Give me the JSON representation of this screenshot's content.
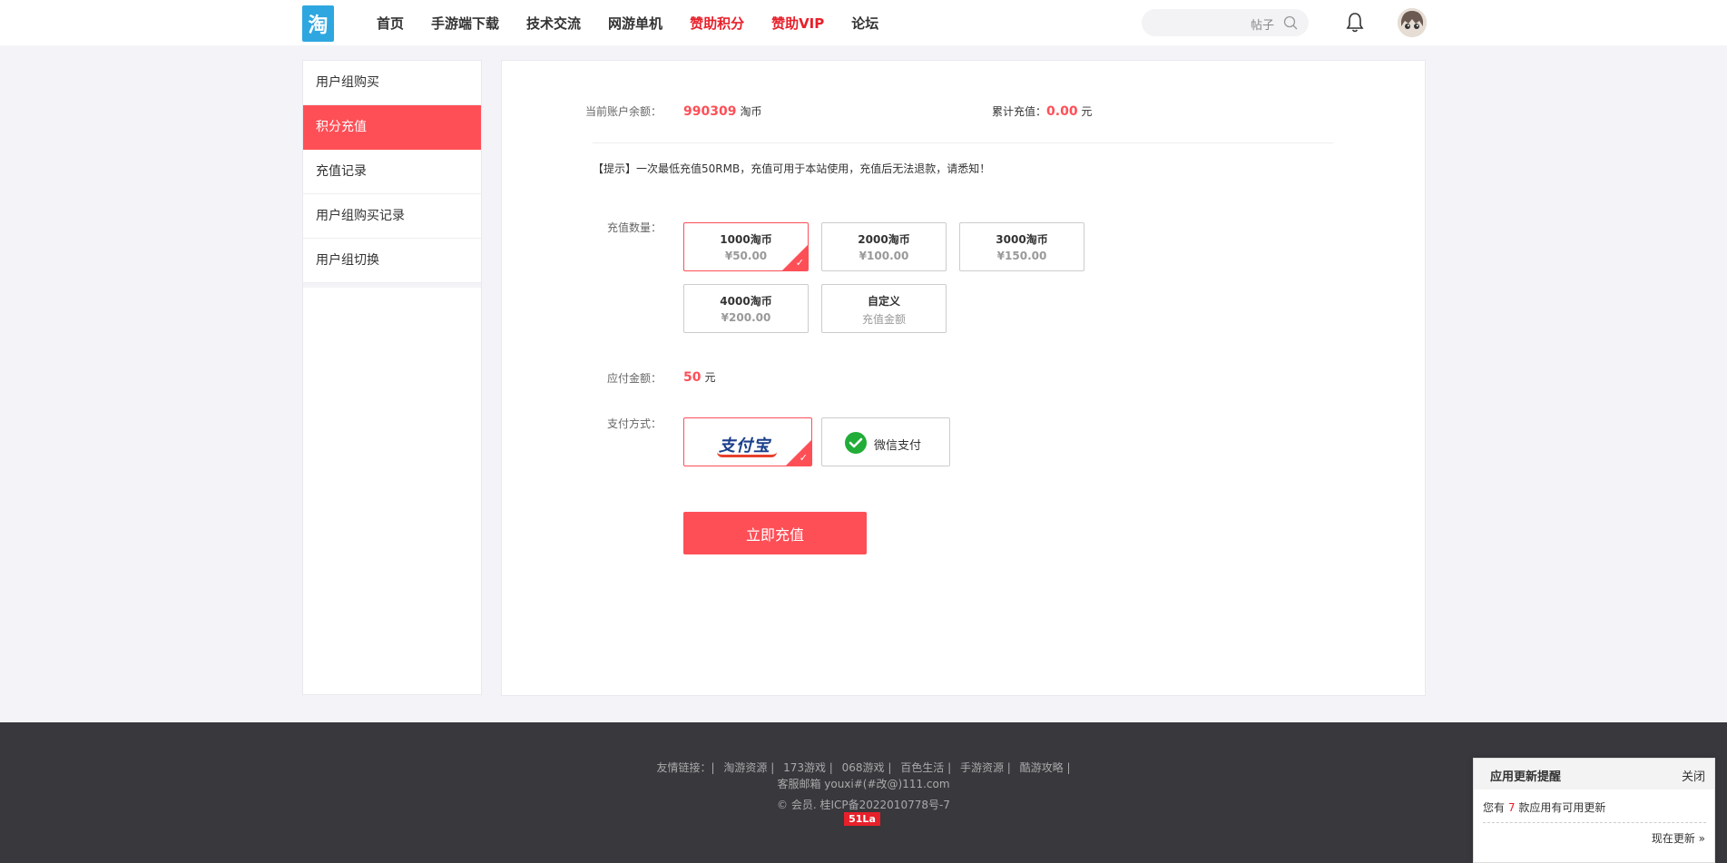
{
  "header": {
    "logo_text": "淘",
    "nav": [
      {
        "label": "首页",
        "accent": false
      },
      {
        "label": "手游端下载",
        "accent": false
      },
      {
        "label": "技术交流",
        "accent": false
      },
      {
        "label": "网游单机",
        "accent": false
      },
      {
        "label": "赞助积分",
        "accent": true
      },
      {
        "label": "赞助VIP",
        "accent": true
      },
      {
        "label": "论坛",
        "accent": false
      }
    ],
    "search_placeholder": "帖子"
  },
  "sidebar": {
    "items": [
      {
        "label": "用户组购买",
        "active": false
      },
      {
        "label": "积分充值",
        "active": true
      },
      {
        "label": "充值记录",
        "active": false
      },
      {
        "label": "用户组购买记录",
        "active": false
      },
      {
        "label": "用户组切换",
        "active": false
      }
    ]
  },
  "recharge": {
    "balance_label": "当前账户余额：",
    "balance_value": "990309",
    "balance_unit": "淘币",
    "total_label": "累计充值：",
    "total_value": "0.00",
    "total_unit": "元",
    "tip": "【提示】一次最低充值50RMB，充值可用于本站使用，充值后无法退款，请悉知！",
    "amount_label": "充值数量：",
    "options": [
      {
        "name": "1000淘币",
        "price": "¥50.00",
        "selected": true
      },
      {
        "name": "2000淘币",
        "price": "¥100.00",
        "selected": false
      },
      {
        "name": "3000淘币",
        "price": "¥150.00",
        "selected": false
      },
      {
        "name": "4000淘币",
        "price": "¥200.00",
        "selected": false
      },
      {
        "name": "自定义",
        "price": "充值金额",
        "selected": false
      }
    ],
    "pay_label": "应付金额：",
    "pay_value": "50",
    "pay_unit": "元",
    "method_label": "支付方式：",
    "methods": {
      "alipay": "支付宝",
      "wechat": "微信支付"
    },
    "check_mark": "✓",
    "submit_label": "立即充值"
  },
  "footer": {
    "links_label": "友情链接：|",
    "links": [
      "淘游资源 |",
      "173游戏 |",
      "068游戏 |",
      "百色生活 |",
      "手游资源 |",
      "酷游攻略 |"
    ],
    "mail": "客服邮箱 youxi#(#改@)111.com",
    "copyright": "© 会员. 桂ICP备2022010778号-7",
    "badge": "51La"
  },
  "popup": {
    "title": "应用更新提醒",
    "close": "关闭",
    "body_prefix": "您有",
    "count": "7",
    "body_suffix": "款应用有可用更新",
    "action": "现在更新 »"
  },
  "colors": {
    "accent": "#fe4f57",
    "logo": "#2ea7e0",
    "footer_bg": "#38383d"
  }
}
